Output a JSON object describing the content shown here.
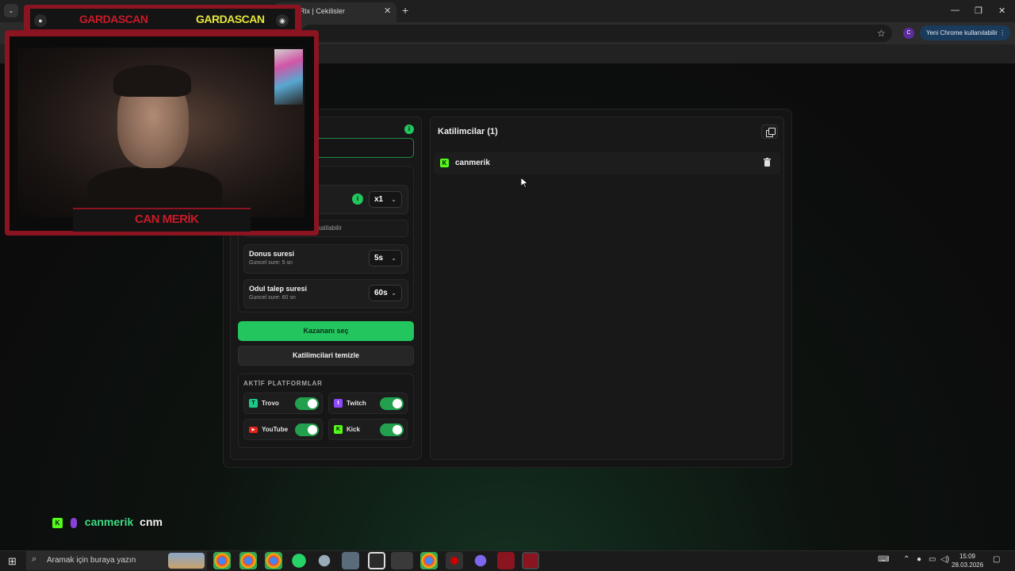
{
  "browser": {
    "tab_title": "Rix | Cekilisler",
    "tab_close": "✕",
    "new_tab": "+",
    "tab_dropdown": "⌄",
    "window_controls": [
      "—",
      "❐",
      "✕"
    ],
    "bookmark_star": "☆",
    "profile_initial": "C",
    "update_label": "Yeni Chrome kullanılabilir",
    "update_menu": "⋮"
  },
  "left_panel": {
    "note_text": "katilabilir",
    "multiplier": {
      "value": "x1",
      "chevron": "⌄"
    },
    "donus": {
      "title": "Donus suresi",
      "sub": "Guncel sure: 5 sn",
      "value": "5s",
      "chevron": "⌄"
    },
    "odul": {
      "title": "Odul talep suresi",
      "sub": "Guncel sure: 60 sn",
      "value": "60s",
      "chevron": "⌄"
    },
    "pick_winner_label": "Kazananı seç",
    "clear_label": "Katilimcilari temizle",
    "platforms_title": "AKTİF PLATFORMLAR",
    "platforms": [
      {
        "name": "Trovo",
        "enabled": true
      },
      {
        "name": "Twitch",
        "enabled": true
      },
      {
        "name": "YouTube",
        "enabled": true
      },
      {
        "name": "Kick",
        "enabled": true
      }
    ]
  },
  "right_panel": {
    "title": "Katilimcilar (1)",
    "participants": [
      {
        "name": "canmerik",
        "platform": "kick-icon"
      }
    ]
  },
  "overlay": {
    "brand_left": "GARDASCAN",
    "brand_right": "GARDASCAN",
    "name_plate": "CAN MERİK",
    "chat_user": "canmerik",
    "chat_message": "cnm"
  },
  "taskbar": {
    "search_placeholder": "Aramak için buraya yazın",
    "time": "15:09",
    "date": "28.03.2026"
  },
  "colors": {
    "accent_green": "#22c55e",
    "kick_green": "#53fc18",
    "overlay_red": "#8a1420"
  }
}
